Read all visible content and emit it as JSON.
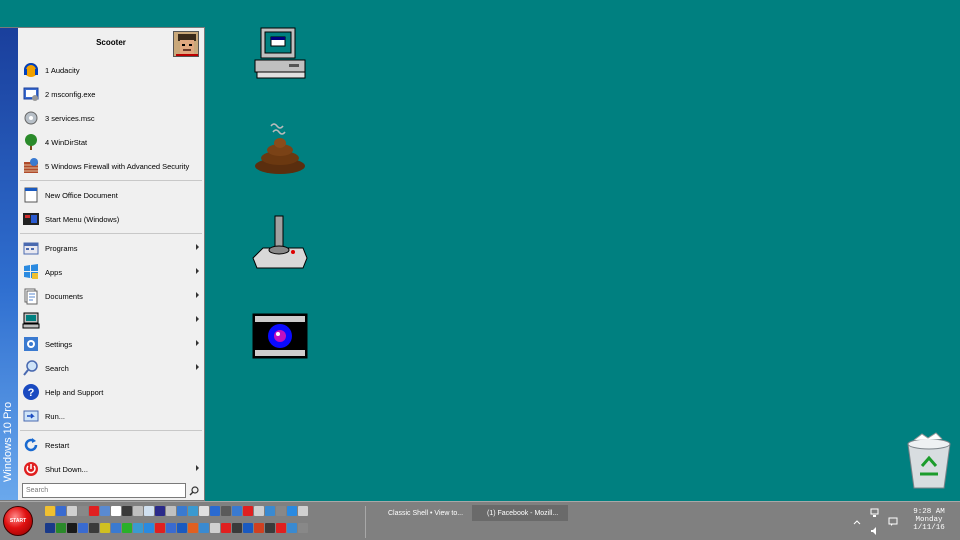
{
  "start_menu": {
    "user_name": "Scooter",
    "banner_text": "Windows 10 Pro",
    "recent_items": [
      {
        "label": "1 Audacity",
        "icon": "audacity-icon"
      },
      {
        "label": "2 msconfig.exe",
        "icon": "msconfig-icon"
      },
      {
        "label": "3 services.msc",
        "icon": "services-icon"
      },
      {
        "label": "4 WinDirStat",
        "icon": "windirstat-icon"
      },
      {
        "label": "5 Windows Firewall with Advanced Security",
        "icon": "firewall-icon"
      }
    ],
    "pinned_items": [
      {
        "label": "New Office Document",
        "icon": "office-document-icon"
      },
      {
        "label": "Start Menu (Windows)",
        "icon": "windows-start-icon"
      }
    ],
    "main_items": [
      {
        "label": "Programs",
        "icon": "programs-icon",
        "submenu": true
      },
      {
        "label": "Apps",
        "icon": "apps-icon",
        "submenu": true
      },
      {
        "label": "Documents",
        "icon": "documents-icon",
        "submenu": true
      },
      {
        "label": "",
        "icon": "computer-icon",
        "submenu": true
      },
      {
        "label": "Settings",
        "icon": "settings-icon",
        "submenu": true
      },
      {
        "label": "Search",
        "icon": "search-icon",
        "submenu": true
      },
      {
        "label": "Help and Support",
        "icon": "help-icon",
        "submenu": false
      },
      {
        "label": "Run...",
        "icon": "run-icon",
        "submenu": false
      }
    ],
    "power_items": [
      {
        "label": "Restart",
        "icon": "restart-icon",
        "submenu": false
      },
      {
        "label": "Shut Down...",
        "icon": "shutdown-icon",
        "submenu": true
      }
    ],
    "search_placeholder": "Search"
  },
  "desktop_icons": [
    {
      "name": "computer-desktop-icon"
    },
    {
      "name": "poop-desktop-icon"
    },
    {
      "name": "joystick-desktop-icon"
    },
    {
      "name": "camera-desktop-icon"
    },
    {
      "name": "recycle-bin-desktop-icon"
    }
  ],
  "taskbar": {
    "start_label": "START",
    "tasks": [
      {
        "label": "Classic Shell • View to...",
        "icon": "firefox-icon"
      },
      {
        "label": "(1) Facebook - Mozill...",
        "icon": "firefox-icon"
      }
    ],
    "clock": {
      "time": "9:28 AM",
      "day": "Monday",
      "date": "1/11/16"
    }
  },
  "colors": {
    "desktop": "#008080",
    "taskbar": "#808080",
    "banner_top": "#1a3f9c",
    "banner_bottom": "#6aa8ec"
  }
}
